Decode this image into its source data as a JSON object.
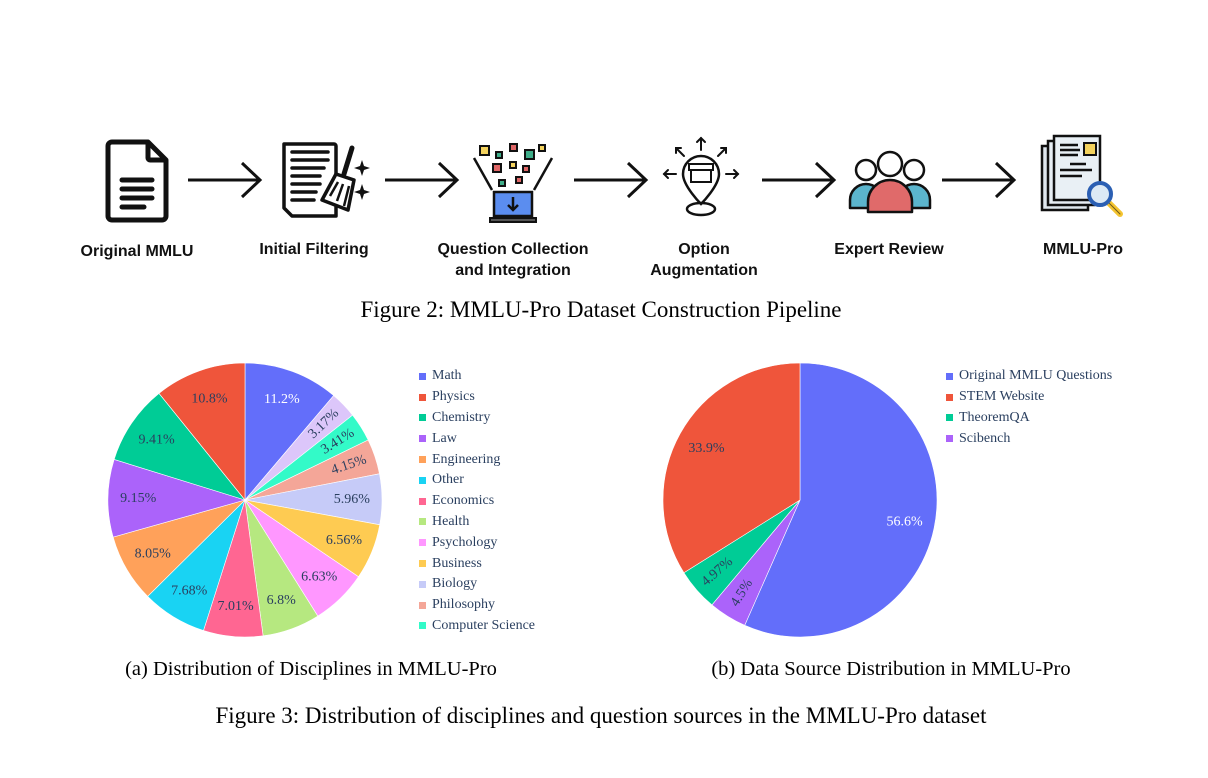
{
  "figure2": {
    "caption": "Figure 2: MMLU-Pro Dataset Construction Pipeline",
    "steps": [
      {
        "label_lines": [
          "Original MMLU"
        ],
        "icon": "document-icon"
      },
      {
        "label_lines": [
          "Initial Filtering"
        ],
        "icon": "document-broom-icon"
      },
      {
        "label_lines": [
          "Question Collection",
          "and Integration"
        ],
        "icon": "laptop-collection-icon"
      },
      {
        "label_lines": [
          "Option",
          "Augmentation"
        ],
        "icon": "location-store-icon"
      },
      {
        "label_lines": [
          "Expert Review"
        ],
        "icon": "people-group-icon"
      },
      {
        "label_lines": [
          "MMLU-Pro"
        ],
        "icon": "document-search-icon"
      }
    ],
    "arrow_icon": "arrow-right-icon"
  },
  "figure3": {
    "caption": "Figure 3: Distribution of disciplines and question sources in the MMLU-Pro dataset",
    "subcaption_a": "(a) Distribution of Disciplines in MMLU-Pro",
    "subcaption_b": "(b) Data Source Distribution in MMLU-Pro"
  },
  "chart_data": [
    {
      "type": "pie",
      "title": "(a) Distribution of Disciplines in MMLU-Pro",
      "start_angle": "12 o'clock",
      "direction": "clockwise",
      "legend_placement": "right",
      "categories": [
        "Math",
        "Physics",
        "Chemistry",
        "Law",
        "Engineering",
        "Other",
        "Economics",
        "Health",
        "Psychology",
        "Business",
        "Biology",
        "Philosophy",
        "Computer Science"
      ],
      "values": [
        11.2,
        10.8,
        9.41,
        9.15,
        8.05,
        7.68,
        7.01,
        6.8,
        6.63,
        6.56,
        5.96,
        4.15,
        3.41,
        3.17
      ],
      "slices": [
        {
          "label": "Math",
          "value": 11.2,
          "text": "11.2%",
          "color": "#636efa",
          "text_color": "#ffffff"
        },
        {
          "label": "Law",
          "value": 3.17,
          "text": "3.17%",
          "color": "#dcc6fa",
          "text_color": "#2a3f5f",
          "rotated": true
        },
        {
          "label": "Computer Science",
          "value": 3.41,
          "text": "3.41%",
          "color": "#33fac8",
          "text_color": "#2a3f5f",
          "rotated": true
        },
        {
          "label": "Philosophy",
          "value": 4.15,
          "text": "4.15%",
          "color": "#f4a698",
          "text_color": "#2a3f5f",
          "rotated": true
        },
        {
          "label": "Biology",
          "value": 5.96,
          "text": "5.96%",
          "color": "#c6cbf8",
          "text_color": "#2a3f5f"
        },
        {
          "label": "Business",
          "value": 6.56,
          "text": "6.56%",
          "color": "#fecb52",
          "text_color": "#2a3f5f"
        },
        {
          "label": "Psychology",
          "value": 6.63,
          "text": "6.63%",
          "color": "#ff97ff",
          "text_color": "#2a3f5f"
        },
        {
          "label": "Health",
          "value": 6.8,
          "text": "6.8%",
          "color": "#b6e880",
          "text_color": "#2a3f5f"
        },
        {
          "label": "Economics",
          "value": 7.01,
          "text": "7.01%",
          "color": "#ff6692",
          "text_color": "#2a3f5f"
        },
        {
          "label": "Other",
          "value": 7.68,
          "text": "7.68%",
          "color": "#19d3f3",
          "text_color": "#2a3f5f"
        },
        {
          "label": "Engineering",
          "value": 8.05,
          "text": "8.05%",
          "color": "#ffa15a",
          "text_color": "#2a3f5f"
        },
        {
          "label": "Law",
          "value": 9.15,
          "text": "9.15%",
          "color": "#ab63fa",
          "text_color": "#2a3f5f"
        },
        {
          "label": "Chemistry",
          "value": 9.41,
          "text": "9.41%",
          "color": "#00cc96",
          "text_color": "#2a3f5f"
        },
        {
          "label": "Physics",
          "value": 10.8,
          "text": "10.8%",
          "color": "#ef553b",
          "text_color": "#2a3f5f"
        }
      ],
      "legend": [
        {
          "label": "Math",
          "color": "#636efa"
        },
        {
          "label": "Physics",
          "color": "#ef553b"
        },
        {
          "label": "Chemistry",
          "color": "#00cc96"
        },
        {
          "label": "Law",
          "color": "#ab63fa"
        },
        {
          "label": "Engineering",
          "color": "#ffa15a"
        },
        {
          "label": "Other",
          "color": "#19d3f3"
        },
        {
          "label": "Economics",
          "color": "#ff6692"
        },
        {
          "label": "Health",
          "color": "#b6e880"
        },
        {
          "label": "Psychology",
          "color": "#ff97ff"
        },
        {
          "label": "Business",
          "color": "#fecb52"
        },
        {
          "label": "Biology",
          "color": "#c6cbf8"
        },
        {
          "label": "Philosophy",
          "color": "#f4a698"
        },
        {
          "label": "Computer Science",
          "color": "#33fac8"
        }
      ]
    },
    {
      "type": "pie",
      "title": "(b) Data Source Distribution in MMLU-Pro",
      "start_angle": "12 o'clock",
      "direction": "clockwise",
      "legend_placement": "right",
      "categories": [
        "Original MMLU Questions",
        "STEM Website",
        "TheoremQA",
        "Scibench"
      ],
      "values": [
        56.6,
        33.9,
        4.97,
        4.5
      ],
      "slices": [
        {
          "label": "Original MMLU Questions",
          "value": 56.6,
          "text": "56.6%",
          "color": "#636efa",
          "text_color": "#ffffff"
        },
        {
          "label": "Scibench",
          "value": 4.5,
          "text": "4.5%",
          "color": "#ab63fa",
          "text_color": "#2a3f5f",
          "rotated": true
        },
        {
          "label": "TheoremQA",
          "value": 4.97,
          "text": "4.97%",
          "color": "#00cc96",
          "text_color": "#2a3f5f",
          "rotated": true
        },
        {
          "label": "STEM Website",
          "value": 33.9,
          "text": "33.9%",
          "color": "#ef553b",
          "text_color": "#2a3f5f"
        }
      ],
      "legend": [
        {
          "label": "Original MMLU Questions",
          "color": "#636efa"
        },
        {
          "label": "STEM Website",
          "color": "#ef553b"
        },
        {
          "label": "TheoremQA",
          "color": "#00cc96"
        },
        {
          "label": "Scibench",
          "color": "#ab63fa"
        }
      ]
    }
  ]
}
